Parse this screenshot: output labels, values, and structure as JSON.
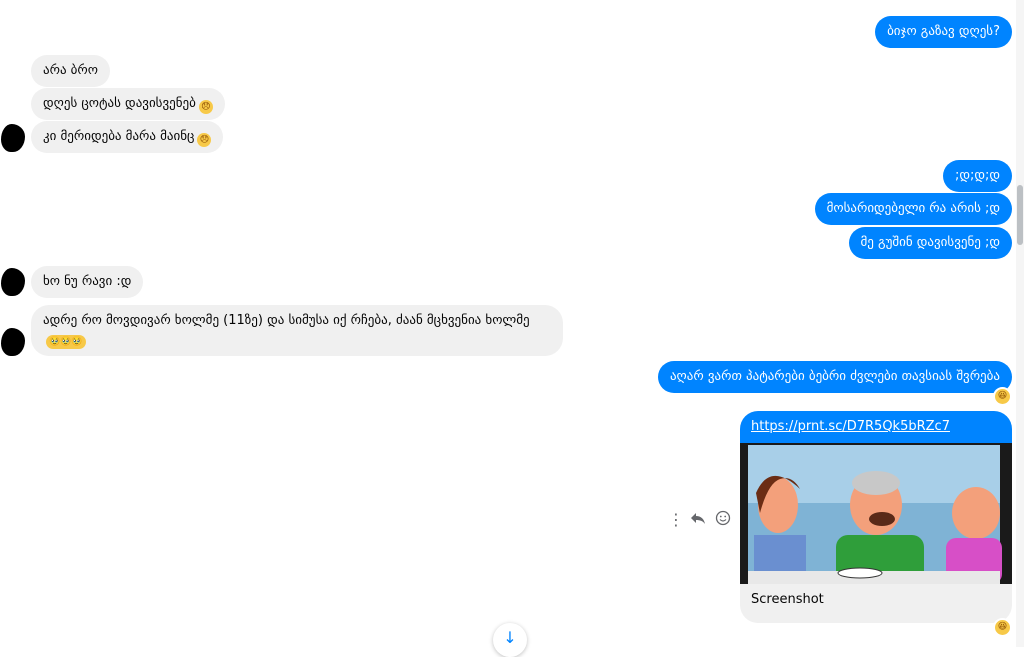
{
  "messages": [
    {
      "id": "m1",
      "dir": "out",
      "text": "ბიჯო გაზავ დღეს?"
    },
    {
      "id": "m2",
      "dir": "in",
      "text": "არა ბრო"
    },
    {
      "id": "m3",
      "dir": "in",
      "text": "დღეს ცოტას დავისვენებ",
      "emoji": "😞"
    },
    {
      "id": "m4",
      "dir": "in",
      "text": "კი მერიდება მარა მაინც",
      "emoji": "😞"
    },
    {
      "id": "m5",
      "dir": "out",
      "text": ";დ;დ;დ"
    },
    {
      "id": "m6",
      "dir": "out",
      "text": "მოსარიდებელი რა არის ;დ"
    },
    {
      "id": "m7",
      "dir": "out",
      "text": "მე გუშინ დავისვენე ;დ"
    },
    {
      "id": "m8",
      "dir": "in",
      "text": "ხო ნუ რავი :დ"
    },
    {
      "id": "m9",
      "dir": "in",
      "text": "ადრე რო მოვდივარ ხოლმე (11ზე) და სიმუსა იქ რჩება, ძაან მცხვენია ხოლმე",
      "emoji": "🥹🥹🥹"
    },
    {
      "id": "m10",
      "dir": "out",
      "text": "აღარ ვართ პატარები ბებრი ძვლები თავსიას შვრება",
      "reaction": "😆"
    }
  ],
  "link_card": {
    "url": "https://prnt.sc/D7R5Qk5bRZc7",
    "title": "Screenshot",
    "reaction": "😆"
  },
  "toolbar": {
    "more_icon": "more-vertical-icon",
    "reply_icon": "reply-icon",
    "react_icon": "smiley-icon"
  },
  "scroll_down_icon": "arrow-down-icon",
  "colors": {
    "outgoing": "#0084ff",
    "incoming": "#f0f0f0",
    "text_out": "#ffffff",
    "text_in": "#050505"
  }
}
